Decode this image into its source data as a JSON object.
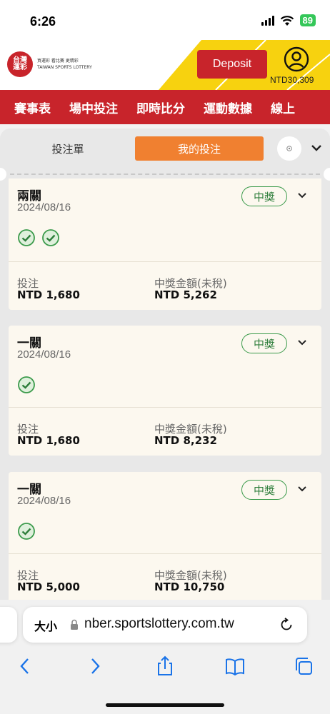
{
  "status_bar": {
    "time": "6:26",
    "battery": "89"
  },
  "header": {
    "logo_line1": "台灣",
    "logo_line2": "運彩",
    "logo_tagline_1": "買運彩 看比賽 更精彩",
    "logo_tagline_2": "TAIWAN SPORTS LOTTERY",
    "deposit_label": "Deposit",
    "balance": "NTD30,309"
  },
  "nav": {
    "items": [
      {
        "label": "賽事表"
      },
      {
        "label": "場中投注"
      },
      {
        "label": "即時比分"
      },
      {
        "label": "運動數據"
      },
      {
        "label": "線上"
      }
    ]
  },
  "panel": {
    "tab_bet_slip": "投注單",
    "tab_my_bets": "我的投注",
    "bets": [
      {
        "title": "兩關",
        "date": "2024/08/16",
        "status": "中獎",
        "checks": 2,
        "stake_label": "投注",
        "stake": "NTD 1,680",
        "payout_label": "中獎金額(未稅)",
        "payout": "NTD 5,262"
      },
      {
        "title": "一關",
        "date": "2024/08/16",
        "status": "中獎",
        "checks": 1,
        "stake_label": "投注",
        "stake": "NTD 1,680",
        "payout_label": "中獎金額(未稅)",
        "payout": "NTD 8,232"
      },
      {
        "title": "一關",
        "date": "2024/08/16",
        "status": "中獎",
        "checks": 1,
        "stake_label": "投注",
        "stake": "NTD 5,000",
        "payout_label": "中獎金額(未稅)",
        "payout": "NTD 10,750"
      }
    ]
  },
  "browser": {
    "text_size_label": "大小",
    "url": "nber.sportslottery.com.tw"
  },
  "colors": {
    "brand_red": "#c8242b",
    "accent_orange": "#f08030",
    "header_yellow": "#f7d20f",
    "win_green": "#3a9a4a"
  }
}
